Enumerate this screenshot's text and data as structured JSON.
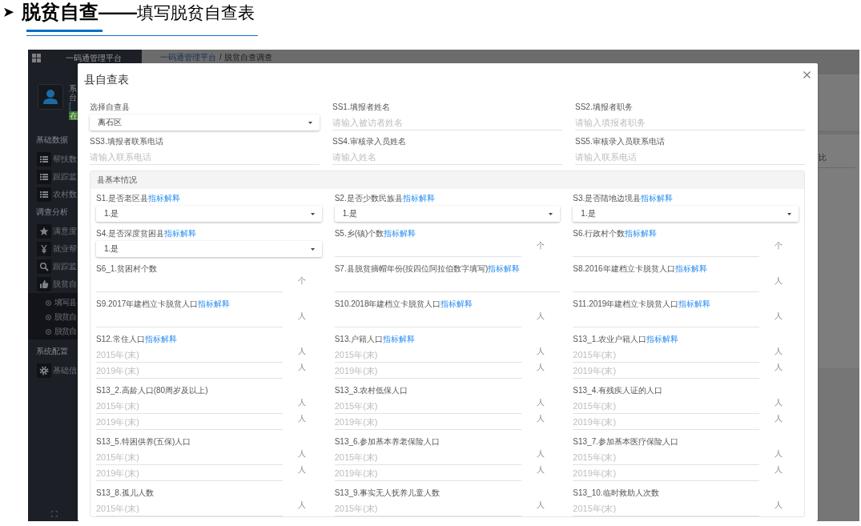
{
  "slide": {
    "bullet": "➤",
    "heading": "**脱贫自查——**填写脱贫自查表"
  },
  "sidebar": {
    "app_title": "一码通管理平台",
    "user": {
      "name": "系",
      "role": "台",
      "link": "[",
      "badge": "在"
    },
    "groups": [
      {
        "heading": "基础数据",
        "items": [
          {
            "kind": "list",
            "label": "帮扶数"
          },
          {
            "kind": "list",
            "label": "跟踪监"
          },
          {
            "kind": "list",
            "label": "农村数"
          }
        ]
      },
      {
        "heading": "调查分析",
        "items": [
          {
            "kind": "star",
            "label": "满意度"
          },
          {
            "kind": "yen",
            "label": "就业帮"
          },
          {
            "kind": "search",
            "label": "跟踪监"
          },
          {
            "kind": "like",
            "label": "脱贫自",
            "expanded": true,
            "children": [
              {
                "label": "填写县"
              },
              {
                "label": "脱贫自"
              },
              {
                "label": "脱贫自"
              }
            ]
          }
        ]
      },
      {
        "heading": "系统配置",
        "items": [
          {
            "kind": "gear",
            "label": "基础信"
          }
        ]
      }
    ]
  },
  "page": {
    "breadcrumb": {
      "link": "一码通管理平台",
      "current": "/ 脱贫自查调查"
    },
    "column_header": "比"
  },
  "modal": {
    "title": "县自查表",
    "fields": [
      {
        "kind": "select",
        "label": "选择自查县",
        "value": "离石区"
      },
      {
        "kind": "input",
        "label": "SS1.填报者姓名",
        "placeholder": "请输入被访者姓名"
      },
      {
        "kind": "input",
        "label": "SS2.填报者职务",
        "placeholder": "请输入填报者职务"
      },
      {
        "kind": "input",
        "label": "SS3.填报者联系电话",
        "placeholder": "请输入联系电话"
      },
      {
        "kind": "input",
        "label": "SS4.审核录入员姓名",
        "placeholder": "请输入姓名"
      },
      {
        "kind": "input",
        "label": "SS5.审核录入员联系电话",
        "placeholder": "请输入联系电话"
      }
    ],
    "section": {
      "title": "县基本情况",
      "fields": [
        {
          "kind": "select",
          "label": "S1.是否老区县",
          "link": "指标解释",
          "value": "1.是"
        },
        {
          "kind": "select",
          "label": "S2.是否少数民族县",
          "link": "指标解释",
          "value": "1.是"
        },
        {
          "kind": "select",
          "label": "S3.是否陆地边境县",
          "link": "指标解释",
          "value": "1.是"
        },
        {
          "kind": "select",
          "label": "S4.是否深度贫困县",
          "link": "指标解释",
          "value": "1.是"
        },
        {
          "kind": "number",
          "label": "S5.乡(镇)个数",
          "link": "指标解释",
          "inputs": [
            {
              "unit": "个"
            }
          ]
        },
        {
          "kind": "number",
          "label": "S6.行政村个数",
          "link": "指标解释",
          "inputs": [
            {
              "unit": "个"
            }
          ]
        },
        {
          "kind": "number",
          "label": "S6_1.贫困村个数",
          "inputs": [
            {
              "unit": "个"
            }
          ]
        },
        {
          "kind": "input",
          "label": "S7.县脱贫摘帽年份(按四位阿拉伯数字填写)",
          "link": "指标解释"
        },
        {
          "kind": "number",
          "label": "S8.2016年建档立卡脱贫人口",
          "link": "指标解释",
          "inputs": [
            {
              "unit": "人"
            }
          ]
        },
        {
          "kind": "number",
          "label": "S9.2017年建档立卡脱贫人口",
          "link": "指标解释",
          "inputs": [
            {
              "unit": "人"
            }
          ]
        },
        {
          "kind": "number",
          "label": "S10.2018年建档立卡脱贫人口",
          "link": "指标解释",
          "inputs": [
            {
              "unit": "人"
            }
          ]
        },
        {
          "kind": "number",
          "label": "S11.2019年建档立卡脱贫人口",
          "link": "指标解释",
          "inputs": [
            {
              "unit": "人"
            }
          ]
        },
        {
          "kind": "number",
          "label": "S12.常住人口",
          "link": "指标解释",
          "inputs": [
            {
              "placeholder": "2015年(末)",
              "unit": "人"
            },
            {
              "placeholder": "2019年(末)",
              "unit": "人"
            }
          ]
        },
        {
          "kind": "number",
          "label": "S13.户籍人口",
          "link": "指标解释",
          "inputs": [
            {
              "placeholder": "2015年(末)",
              "unit": "人"
            },
            {
              "placeholder": "2019年(末)",
              "unit": "人"
            }
          ]
        },
        {
          "kind": "number",
          "label": "S13_1.农业户籍人口",
          "link": "指标解释",
          "inputs": [
            {
              "placeholder": "2015年(末)",
              "unit": "人"
            },
            {
              "placeholder": "2019年(末)",
              "unit": "人"
            }
          ]
        },
        {
          "kind": "number",
          "label": "S13_2.高龄人口(80周岁及以上)",
          "inputs": [
            {
              "placeholder": "2015年(末)",
              "unit": "人"
            },
            {
              "placeholder": "2019年(末)",
              "unit": "人"
            }
          ]
        },
        {
          "kind": "number",
          "label": "S13_3.农村低保人口",
          "inputs": [
            {
              "placeholder": "2015年(末)",
              "unit": "人"
            },
            {
              "placeholder": "2019年(末)",
              "unit": "人"
            }
          ]
        },
        {
          "kind": "number",
          "label": "S13_4.有残疾人证的人口",
          "inputs": [
            {
              "placeholder": "2015年(末)",
              "unit": "人"
            },
            {
              "placeholder": "2019年(末)",
              "unit": "人"
            }
          ]
        },
        {
          "kind": "number",
          "label": "S13_5.特困供养(五保)人口",
          "inputs": [
            {
              "placeholder": "2015年(末)",
              "unit": "人"
            },
            {
              "placeholder": "2019年(末)",
              "unit": "人"
            }
          ]
        },
        {
          "kind": "number",
          "label": "S13_6.参加基本养老保险人口",
          "inputs": [
            {
              "placeholder": "2015年(末)",
              "unit": "人"
            },
            {
              "placeholder": "2019年(末)",
              "unit": "人"
            }
          ]
        },
        {
          "kind": "number",
          "label": "S13_7.参加基本医疗保险人口",
          "inputs": [
            {
              "placeholder": "2015年(末)",
              "unit": "人"
            },
            {
              "placeholder": "2019年(末)",
              "unit": "人"
            }
          ]
        },
        {
          "kind": "number",
          "label": "S13_8.孤儿人数",
          "inputs": [
            {
              "placeholder": "2015年(末)",
              "unit": "人"
            }
          ]
        },
        {
          "kind": "number",
          "label": "S13_9.事实无人抚养儿童人数",
          "inputs": [
            {
              "placeholder": "2015年(末)",
              "unit": "人"
            }
          ]
        },
        {
          "kind": "number",
          "label": "S13_10.临时救助人次数",
          "inputs": [
            {
              "placeholder": "2015年(末)",
              "unit": "人"
            }
          ]
        }
      ]
    }
  }
}
